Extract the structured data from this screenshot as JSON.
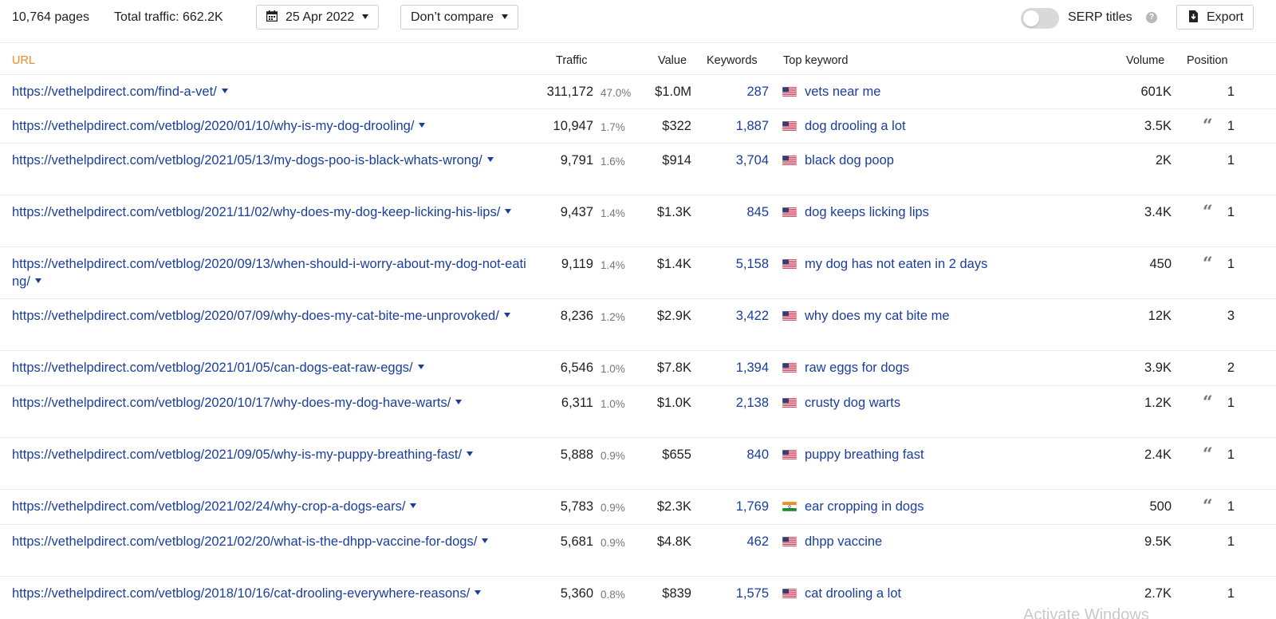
{
  "toolbar": {
    "pages": "10,764 pages",
    "total_traffic": "Total traffic: 662.2K",
    "date": "25 Apr 2022",
    "compare": "Don’t compare",
    "serp_titles": "SERP titles",
    "serp_toggle_on": false,
    "export": "Export"
  },
  "columns": {
    "url": "URL",
    "traffic": "Traffic",
    "value": "Value",
    "keywords": "Keywords",
    "top_keyword": "Top keyword",
    "volume": "Volume",
    "position": "Position"
  },
  "rows": [
    {
      "url": "https://vethelpdirect.com/find-a-vet/",
      "traffic": "311,172",
      "pct": "47.0%",
      "value": "$1.0M",
      "keywords": "287",
      "flag": "us",
      "top_keyword": "vets near me",
      "volume": "601K",
      "quote": false,
      "position": "1"
    },
    {
      "url": "https://vethelpdirect.com/vetblog/2020/01/10/why-is-my-dog-drooling/",
      "traffic": "10,947",
      "pct": "1.7%",
      "value": "$322",
      "keywords": "1,887",
      "flag": "us",
      "top_keyword": "dog drooling a lot",
      "volume": "3.5K",
      "quote": true,
      "position": "1"
    },
    {
      "url": "https://vethelpdirect.com/vetblog/2021/05/13/my-dogs-poo-is-black-whats-wrong/",
      "traffic": "9,791",
      "pct": "1.6%",
      "value": "$914",
      "keywords": "3,704",
      "flag": "us",
      "top_keyword": "black dog poop",
      "volume": "2K",
      "quote": false,
      "position": "1"
    },
    {
      "url": "https://vethelpdirect.com/vetblog/2021/11/02/why-does-my-dog-keep-licking-his-lips/",
      "traffic": "9,437",
      "pct": "1.4%",
      "value": "$1.3K",
      "keywords": "845",
      "flag": "us",
      "top_keyword": "dog keeps licking lips",
      "volume": "3.4K",
      "quote": true,
      "position": "1"
    },
    {
      "url": "https://vethelpdirect.com/vetblog/2020/09/13/when-should-i-worry-about-my-dog-not-eating/",
      "traffic": "9,119",
      "pct": "1.4%",
      "value": "$1.4K",
      "keywords": "5,158",
      "flag": "us",
      "top_keyword": "my dog has not eaten in 2 days",
      "volume": "450",
      "quote": true,
      "position": "1"
    },
    {
      "url": "https://vethelpdirect.com/vetblog/2020/07/09/why-does-my-cat-bite-me-unprovoked/",
      "traffic": "8,236",
      "pct": "1.2%",
      "value": "$2.9K",
      "keywords": "3,422",
      "flag": "us",
      "top_keyword": "why does my cat bite me",
      "volume": "12K",
      "quote": false,
      "position": "3"
    },
    {
      "url": "https://vethelpdirect.com/vetblog/2021/01/05/can-dogs-eat-raw-eggs/",
      "traffic": "6,546",
      "pct": "1.0%",
      "value": "$7.8K",
      "keywords": "1,394",
      "flag": "us",
      "top_keyword": "raw eggs for dogs",
      "volume": "3.9K",
      "quote": false,
      "position": "2"
    },
    {
      "url": "https://vethelpdirect.com/vetblog/2020/10/17/why-does-my-dog-have-warts/",
      "traffic": "6,311",
      "pct": "1.0%",
      "value": "$1.0K",
      "keywords": "2,138",
      "flag": "us",
      "top_keyword": "crusty dog warts",
      "volume": "1.2K",
      "quote": true,
      "position": "1"
    },
    {
      "url": "https://vethelpdirect.com/vetblog/2021/09/05/why-is-my-puppy-breathing-fast/",
      "traffic": "5,888",
      "pct": "0.9%",
      "value": "$655",
      "keywords": "840",
      "flag": "us",
      "top_keyword": "puppy breathing fast",
      "volume": "2.4K",
      "quote": true,
      "position": "1"
    },
    {
      "url": "https://vethelpdirect.com/vetblog/2021/02/24/why-crop-a-dogs-ears/",
      "traffic": "5,783",
      "pct": "0.9%",
      "value": "$2.3K",
      "keywords": "1,769",
      "flag": "in",
      "top_keyword": "ear cropping in dogs",
      "volume": "500",
      "quote": true,
      "position": "1"
    },
    {
      "url": "https://vethelpdirect.com/vetblog/2021/02/20/what-is-the-dhpp-vaccine-for-dogs/",
      "traffic": "5,681",
      "pct": "0.9%",
      "value": "$4.8K",
      "keywords": "462",
      "flag": "us",
      "top_keyword": "dhpp vaccine",
      "volume": "9.5K",
      "quote": false,
      "position": "1"
    },
    {
      "url": "https://vethelpdirect.com/vetblog/2018/10/16/cat-drooling-everywhere-reasons/",
      "traffic": "5,360",
      "pct": "0.8%",
      "value": "$839",
      "keywords": "1,575",
      "flag": "us",
      "top_keyword": "cat drooling a lot",
      "volume": "2.7K",
      "quote": false,
      "position": "1"
    }
  ],
  "watermark": "Activate Windows"
}
